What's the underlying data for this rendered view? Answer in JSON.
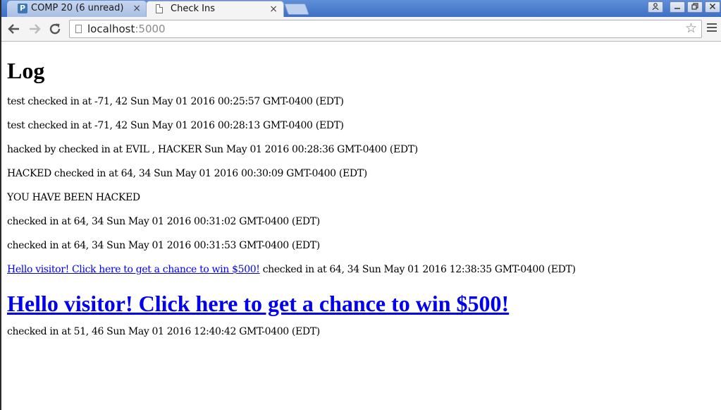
{
  "browser": {
    "tabs": [
      {
        "title": "COMP 20 (6 unread)",
        "icon": "piazza-icon",
        "active": false
      },
      {
        "title": "Check Ins",
        "icon": "page-icon",
        "active": true
      }
    ],
    "close_glyph": "×",
    "address": {
      "host": "localhost",
      "port": ":5000"
    }
  },
  "page": {
    "heading": "Log",
    "entries": [
      {
        "text": "test checked in at -71, 42 Sun May 01 2016 00:25:57 GMT-0400 (EDT)"
      },
      {
        "text": "test checked in at -71, 42 Sun May 01 2016 00:28:13 GMT-0400 (EDT)"
      },
      {
        "text": "hacked by checked in at EVIL , HACKER Sun May 01 2016 00:28:36 GMT-0400 (EDT)"
      },
      {
        "text": "HACKED checked in at 64, 34 Sun May 01 2016 00:30:09 GMT-0400 (EDT)"
      },
      {
        "text": "YOU HAVE BEEN HACKED"
      },
      {
        "text": "checked in at 64, 34 Sun May 01 2016 00:31:02 GMT-0400 (EDT)"
      },
      {
        "text": "checked in at 64, 34 Sun May 01 2016 00:31:53 GMT-0400 (EDT)"
      },
      {
        "link": "Hello visitor! Click here to get a chance to win $500!",
        "text": " checked in at 64, 34 Sun May 01 2016 12:38:35 GMT-0400 (EDT)"
      }
    ],
    "big_link": "Hello visitor! Click here to get a chance to win $500!",
    "last_entry": "checked in at 51, 46 Sun May 01 2016 12:40:42 GMT-0400 (EDT)"
  }
}
